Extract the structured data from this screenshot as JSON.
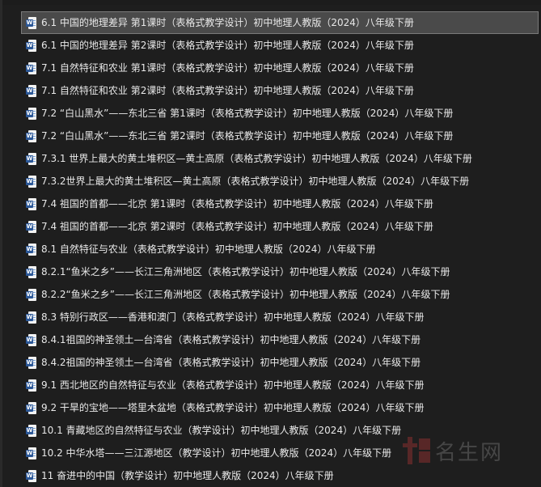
{
  "files": [
    {
      "name": "6.1 中国的地理差异 第1课时（表格式教学设计）初中地理人教版（2024）八年级下册",
      "selected": true
    },
    {
      "name": "6.1 中国的地理差异 第2课时（表格式教学设计）初中地理人教版（2024）八年级下册",
      "selected": false
    },
    {
      "name": "7.1 自然特征和农业 第1课时（表格式教学设计）初中地理人教版（2024）八年级下册",
      "selected": false
    },
    {
      "name": "7.1 自然特征和农业 第2课时（表格式教学设计）初中地理人教版（2024）八年级下册",
      "selected": false
    },
    {
      "name": "7.2 “白山黑水”——东北三省 第1课时（表格式教学设计）初中地理人教版（2024）八年级下册",
      "selected": false
    },
    {
      "name": "7.2 “白山黑水”——东北三省 第2课时（表格式教学设计）初中地理人教版（2024）八年级下册",
      "selected": false
    },
    {
      "name": "7.3.1 世界上最大的黄土堆积区—黄土高原（表格式教学设计）初中地理人教版（2024）八年级下册",
      "selected": false
    },
    {
      "name": "7.3.2世界上最大的黄土堆积区—黄土高原（表格式教学设计）初中地理人教版（2024）八年级下册",
      "selected": false
    },
    {
      "name": "7.4 祖国的首都——北京 第1课时（表格式教学设计）初中地理人教版（2024）八年级下册",
      "selected": false
    },
    {
      "name": "7.4 祖国的首都——北京 第2课时（表格式教学设计）初中地理人教版（2024）八年级下册",
      "selected": false
    },
    {
      "name": "8.1 自然特征与农业（表格式教学设计）初中地理人教版（2024）八年级下册",
      "selected": false
    },
    {
      "name": "8.2.1“鱼米之乡”——长江三角洲地区（表格式教学设计）初中地理人教版（2024）八年级下册",
      "selected": false
    },
    {
      "name": "8.2.2“鱼米之乡”——长江三角洲地区（表格式教学设计）初中地理人教版（2024）八年级下册",
      "selected": false
    },
    {
      "name": "8.3 特别行政区——香港和澳门（表格式教学设计）初中地理人教版（2024）八年级下册",
      "selected": false
    },
    {
      "name": "8.4.1祖国的神圣领土—台湾省（表格式教学设计）初中地理人教版（2024）八年级下册",
      "selected": false
    },
    {
      "name": "8.4.2祖国的神圣领土—台湾省（表格式教学设计）初中地理人教版（2024）八年级下册",
      "selected": false
    },
    {
      "name": "9.1 西北地区的自然特征与农业（表格式教学设计）初中地理人教版（2024）八年级下册",
      "selected": false
    },
    {
      "name": "9.2 干旱的宝地——塔里木盆地（表格式教学设计）初中地理人教版（2024）八年级下册",
      "selected": false
    },
    {
      "name": "10.1 青藏地区的自然特征与农业（教学设计）初中地理人教版（2024）八年级下册",
      "selected": false
    },
    {
      "name": "10.2 中华水塔——三江源地区（教学设计）初中地理人教版（2024）八年级下册",
      "selected": false
    },
    {
      "name": "11 奋进中的中国（教学设计）初中地理人教版（2024）八年级下册",
      "selected": false
    }
  ],
  "icons": {
    "file_icon": "word-document-icon",
    "file_badge": "W"
  },
  "watermark": {
    "text": "名生网"
  },
  "colors": {
    "background": "#1e1e1e",
    "selected_row": "#4a4a4a",
    "word_blue": "#2b5797",
    "text": "#e8e8e8"
  }
}
